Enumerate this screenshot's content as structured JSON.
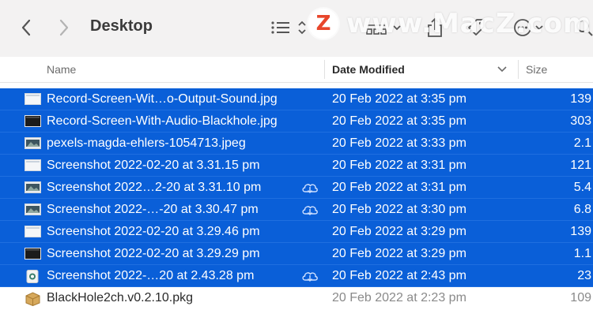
{
  "window": {
    "title": "Desktop",
    "watermark": {
      "logo": "Z",
      "text": "www.MacZ.com"
    }
  },
  "toolbar": {
    "icons": [
      "chevron-left-icon",
      "chevron-right-icon",
      "list-view-icon",
      "group-icon",
      "share-icon",
      "tag-icon",
      "more-icon",
      "search-icon"
    ]
  },
  "columns": {
    "name": "Name",
    "date_modified": "Date Modified",
    "size": "Size"
  },
  "files": [
    {
      "name": "Record-Screen-Wit…o-Output-Sound.jpg",
      "date": "20 Feb 2022 at 3:35 pm",
      "size": "139",
      "icon": "image-white-thumb-icon",
      "cloud": false,
      "selected": true
    },
    {
      "name": "Record-Screen-With-Audio-Blackhole.jpg",
      "date": "20 Feb 2022 at 3:35 pm",
      "size": "303",
      "icon": "image-dark-thumb-icon",
      "cloud": false,
      "selected": true
    },
    {
      "name": "pexels-magda-ehlers-1054713.jpeg",
      "date": "20 Feb 2022 at 3:33 pm",
      "size": "2.1",
      "icon": "photo-thumb-icon",
      "cloud": false,
      "selected": true
    },
    {
      "name": "Screenshot 2022-02-20 at 3.31.15 pm",
      "date": "20 Feb 2022 at 3:31 pm",
      "size": "121",
      "icon": "image-white-thumb-icon",
      "cloud": false,
      "selected": true
    },
    {
      "name": "Screenshot 2022…2-20 at 3.31.10 pm",
      "date": "20 Feb 2022 at 3:31 pm",
      "size": "5.4",
      "icon": "photo-thumb-icon",
      "cloud": true,
      "selected": true
    },
    {
      "name": "Screenshot 2022-…-20 at 3.30.47 pm",
      "date": "20 Feb 2022 at 3:30 pm",
      "size": "6.8",
      "icon": "photo-thumb-icon",
      "cloud": true,
      "selected": true
    },
    {
      "name": "Screenshot 2022-02-20 at 3.29.46 pm",
      "date": "20 Feb 2022 at 3:29 pm",
      "size": "139",
      "icon": "image-white-thumb-icon",
      "cloud": false,
      "selected": true
    },
    {
      "name": "Screenshot 2022-02-20 at 3.29.29 pm",
      "date": "20 Feb 2022 at 3:29 pm",
      "size": "1.1",
      "icon": "image-dark-thumb-icon",
      "cloud": false,
      "selected": true
    },
    {
      "name": "Screenshot 2022-…20 at 2.43.28 pm",
      "date": "20 Feb 2022 at 2:43 pm",
      "size": "23",
      "icon": "app-thumb-icon",
      "cloud": true,
      "selected": true
    },
    {
      "name": "BlackHole2ch.v0.2.10.pkg",
      "date": "20 Feb 2022 at 2:23 pm",
      "size": "109",
      "icon": "package-icon",
      "cloud": false,
      "selected": false
    }
  ],
  "colors": {
    "selection": "#0a5fd8",
    "toolbar_bg": "#f3f2f2",
    "watermark_accent": "#e8462b"
  }
}
